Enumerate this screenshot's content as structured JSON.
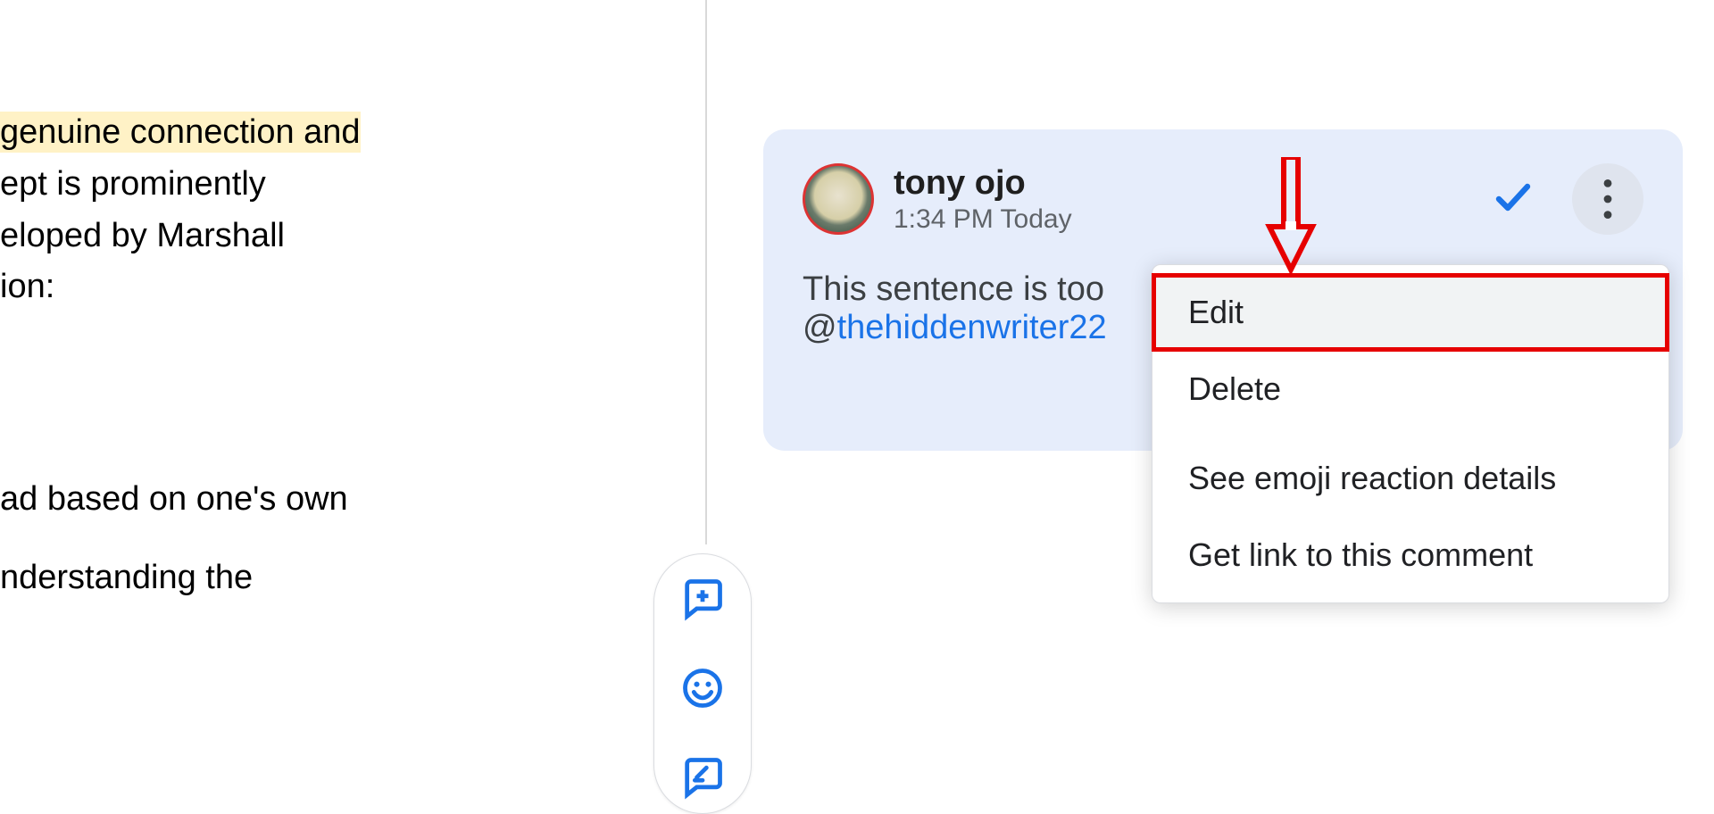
{
  "document": {
    "highlighted_fragment": " genuine connection and",
    "line2": "ept is prominently",
    "line3": "eloped by Marshall",
    "line4": "ion:",
    "block2_line1": "ad based on one's own",
    "block2_line2": "nderstanding the"
  },
  "comment": {
    "author": "tony ojo",
    "timestamp": "1:34 PM Today",
    "body_prefix": "This sentence is too ",
    "mention_prefix": "@",
    "mention_handle": "thehiddenwriter22"
  },
  "menu": {
    "edit": "Edit",
    "delete": "Delete",
    "emoji_details": "See emoji reaction details",
    "get_link": "Get link to this comment"
  },
  "toolbar": {
    "add_comment": "Add comment",
    "emoji": "Add emoji reaction",
    "suggest": "Suggest edits"
  },
  "icons": {
    "resolve": "checkmark-icon",
    "more": "more-vert-icon"
  },
  "annotation": {
    "arrow": "red callout arrow pointing to Edit"
  }
}
